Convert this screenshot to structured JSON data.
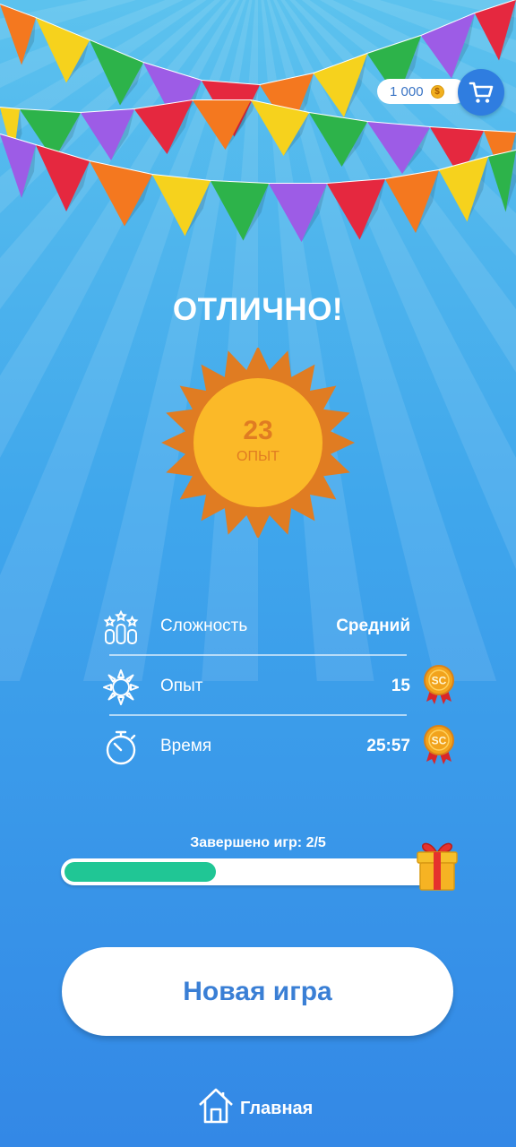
{
  "header": {
    "coin_balance": "1 000",
    "coin_symbol": "$",
    "cart_icon": "shopping-cart-icon"
  },
  "result": {
    "title": "ОТЛИЧНО!",
    "xp_value": "23",
    "xp_unit": "ОПЫТ"
  },
  "stats": [
    {
      "icon": "difficulty-icon",
      "label": "Сложность",
      "value": "Средний"
    },
    {
      "icon": "sun-icon",
      "label": "Опыт",
      "value": "15",
      "medal": "SC"
    },
    {
      "icon": "stopwatch-icon",
      "label": "Время",
      "value": "25:57",
      "medal": "SC"
    }
  ],
  "progress": {
    "label": "Завершено игр: 2/5",
    "completed": 2,
    "total": 5,
    "fill_color": "#20c695",
    "reward_icon": "gift-icon"
  },
  "actions": {
    "new_game_label": "Новая игра",
    "home_label": "Главная"
  },
  "colors": {
    "sun_outer": "#e07c22",
    "sun_inner": "#fbb928",
    "button_text": "#3a7fd5",
    "cart_bg": "#2f7de0"
  }
}
